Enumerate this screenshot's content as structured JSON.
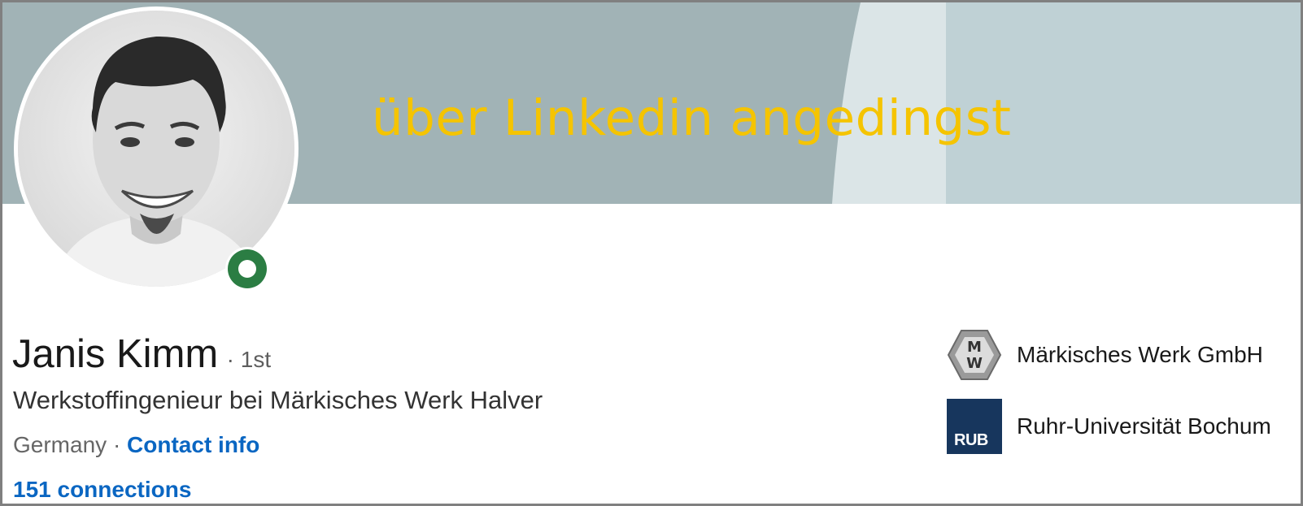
{
  "banner": {
    "text": "über Linkedin angedingst",
    "text_color": "#f5c400",
    "colors": [
      "#a1b3b6",
      "#dbe5e7",
      "#bfd1d5"
    ]
  },
  "profile": {
    "name": "Janis Kimm",
    "degree": "· 1st",
    "headline": "Werkstoffingenieur bei Märkisches Werk Halver",
    "location": "Germany",
    "separator": "·",
    "contact_info_label": "Contact info",
    "connections_label": "151 connections",
    "status": "open-to-work",
    "status_color": "#2b7d43"
  },
  "organizations": [
    {
      "name": "Märkisches Werk GmbH",
      "logo_icon": "mw-hexagon-logo"
    },
    {
      "name": "Ruhr-Universität Bochum",
      "logo_icon": "rub-logo",
      "logo_text": "RUB"
    }
  ],
  "link_color": "#0a66c2"
}
